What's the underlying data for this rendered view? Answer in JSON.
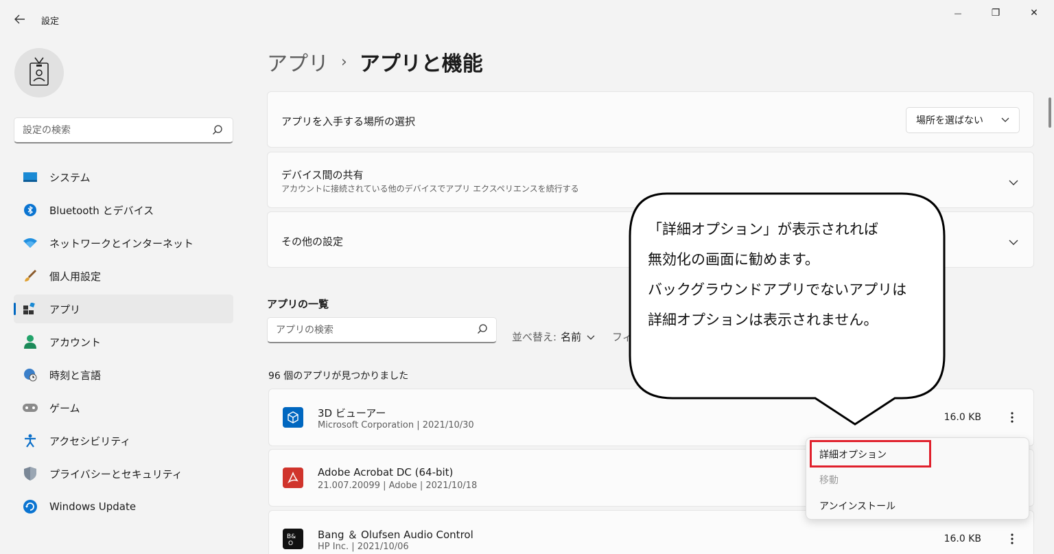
{
  "window": {
    "title": "設定",
    "back_icon": "arrow-left-icon",
    "minimize_glyph": "—",
    "maximize_glyph": "❐",
    "close_glyph": "✕"
  },
  "sidebar": {
    "search_placeholder": "設定の検索",
    "items": [
      {
        "label": "システム",
        "icon": "monitor-icon"
      },
      {
        "label": "Bluetooth とデバイス",
        "icon": "bluetooth-icon"
      },
      {
        "label": "ネットワークとインターネット",
        "icon": "wifi-icon"
      },
      {
        "label": "個人用設定",
        "icon": "brush-icon"
      },
      {
        "label": "アプリ",
        "icon": "apps-icon",
        "active": true
      },
      {
        "label": "アカウント",
        "icon": "person-icon"
      },
      {
        "label": "時刻と言語",
        "icon": "globe-clock-icon"
      },
      {
        "label": "ゲーム",
        "icon": "gamepad-icon"
      },
      {
        "label": "アクセシビリティ",
        "icon": "accessibility-icon"
      },
      {
        "label": "プライバシーとセキュリティ",
        "icon": "shield-icon"
      },
      {
        "label": "Windows Update",
        "icon": "update-icon"
      }
    ]
  },
  "breadcrumb": {
    "parent": "アプリ",
    "separator": "›",
    "current": "アプリと機能"
  },
  "cards": {
    "install_source": {
      "title": "アプリを入手する場所の選択",
      "value": "場所を選ばない"
    },
    "share": {
      "title": "デバイス間の共有",
      "subtitle": "アカウントに接続されている他のデバイスでアプリ エクスペリエンスを続行する"
    },
    "other": {
      "title": "その他の設定"
    }
  },
  "app_list": {
    "title": "アプリの一覧",
    "search_placeholder": "アプリの検索",
    "sort_label": "並べ替え:",
    "sort_value": "名前",
    "filter_label": "フィ",
    "count_text": "96 個のアプリが見つかりました",
    "apps": [
      {
        "name": "3D ビューアー",
        "meta": "Microsoft Corporation  |  2021/10/30",
        "size": "16.0 KB",
        "icon_color": "#0067c0"
      },
      {
        "name": "Adobe Acrobat DC (64-bit)",
        "meta": "21.007.20099  |  Adobe  |  2021/10/18",
        "size": "",
        "icon_color": "#d0342c"
      },
      {
        "name": "Bang ＆ Olufsen Audio Control",
        "meta": "HP Inc.  |  2021/10/06",
        "size": "16.0 KB",
        "icon_color": "#111111",
        "icon_text": "B&O"
      }
    ]
  },
  "context_menu": {
    "items": [
      {
        "label": "詳細オプション",
        "disabled": false
      },
      {
        "label": "移動",
        "disabled": true
      },
      {
        "label": "アンインストール",
        "disabled": false
      }
    ]
  },
  "callout": {
    "lines": [
      "「詳細オプション」が表示されれば",
      "無効化の画面に勧めます。",
      "バックグラウンドアプリでないアプリは",
      "詳細オプションは表示されません。"
    ]
  },
  "colors": {
    "accent": "#0067c0",
    "highlight": "#e0202c"
  }
}
